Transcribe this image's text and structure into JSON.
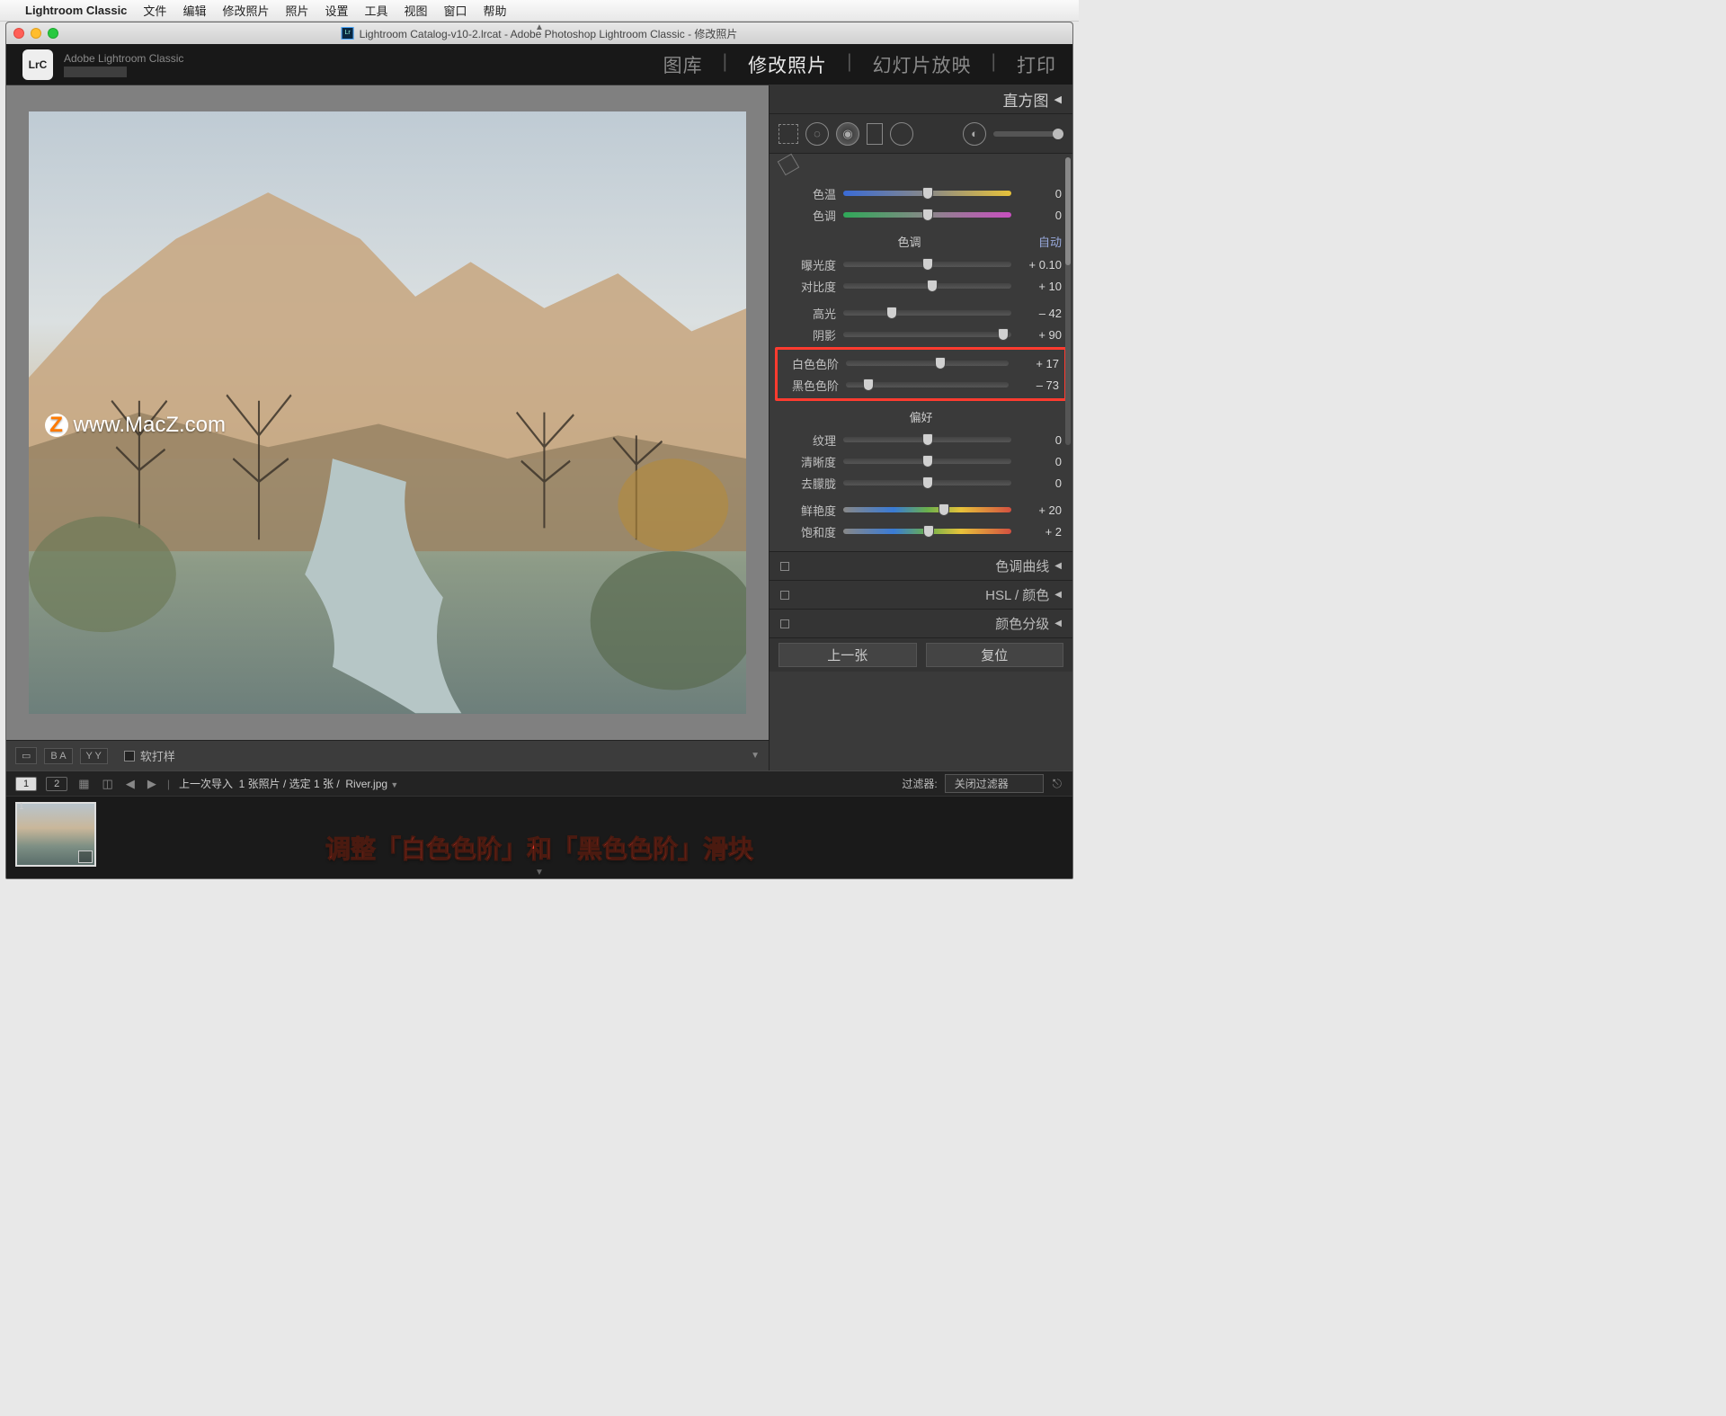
{
  "mac_menu": {
    "apple": "",
    "app": "Lightroom Classic",
    "items": [
      "文件",
      "编辑",
      "修改照片",
      "照片",
      "设置",
      "工具",
      "视图",
      "窗口",
      "帮助"
    ]
  },
  "window_title": "Lightroom Catalog-v10-2.lrcat - Adobe Photoshop Lightroom Classic - 修改照片",
  "identity": {
    "logo_text": "LrC",
    "subtitle": "Adobe Lightroom Classic"
  },
  "modules": {
    "items": [
      "图库",
      "修改照片",
      "幻灯片放映",
      "打印"
    ],
    "active": "修改照片"
  },
  "watermark": "www.MacZ.com",
  "loupe_toolbar": {
    "softproof": "软打样"
  },
  "right_panel": {
    "histogram": "直方图",
    "wb": {
      "temp": "色温",
      "tint": "色调",
      "temp_val": "0",
      "tint_val": "0"
    },
    "tone_section": "色调",
    "auto": "自动",
    "exposure": {
      "label": "曝光度",
      "val": "+ 0.10",
      "pos": 50
    },
    "contrast": {
      "label": "对比度",
      "val": "+ 10",
      "pos": 53
    },
    "highlights": {
      "label": "高光",
      "val": "– 42",
      "pos": 29
    },
    "shadows": {
      "label": "阴影",
      "val": "+ 90",
      "pos": 95
    },
    "whites": {
      "label": "白色色阶",
      "val": "+ 17",
      "pos": 58
    },
    "blacks": {
      "label": "黑色色阶",
      "val": "– 73",
      "pos": 14
    },
    "presence_section": "偏好",
    "texture": {
      "label": "纹理",
      "val": "0",
      "pos": 50
    },
    "clarity": {
      "label": "清晰度",
      "val": "0",
      "pos": 50
    },
    "dehaze": {
      "label": "去朦胧",
      "val": "0",
      "pos": 50
    },
    "vibrance": {
      "label": "鲜艳度",
      "val": "+ 20",
      "pos": 60
    },
    "saturation": {
      "label": "饱和度",
      "val": "+ 2",
      "pos": 51
    },
    "panels": {
      "tone_curve": "色调曲线",
      "hsl": "HSL / 颜色",
      "color_grading": "颜色分级"
    },
    "prev": "上一张",
    "reset": "复位"
  },
  "grid_bar": {
    "views": [
      "1",
      "2"
    ],
    "breadcrumb_prefix": "上一次导入",
    "counts": "1 张照片 / 选定 1 张 /",
    "filename": "River.jpg",
    "filter_label": "过滤器:",
    "filter_value": "关闭过滤器"
  },
  "filmstrip": {
    "idx": "1"
  },
  "caption": "调整「白色色阶」和「黑色色阶」滑块"
}
